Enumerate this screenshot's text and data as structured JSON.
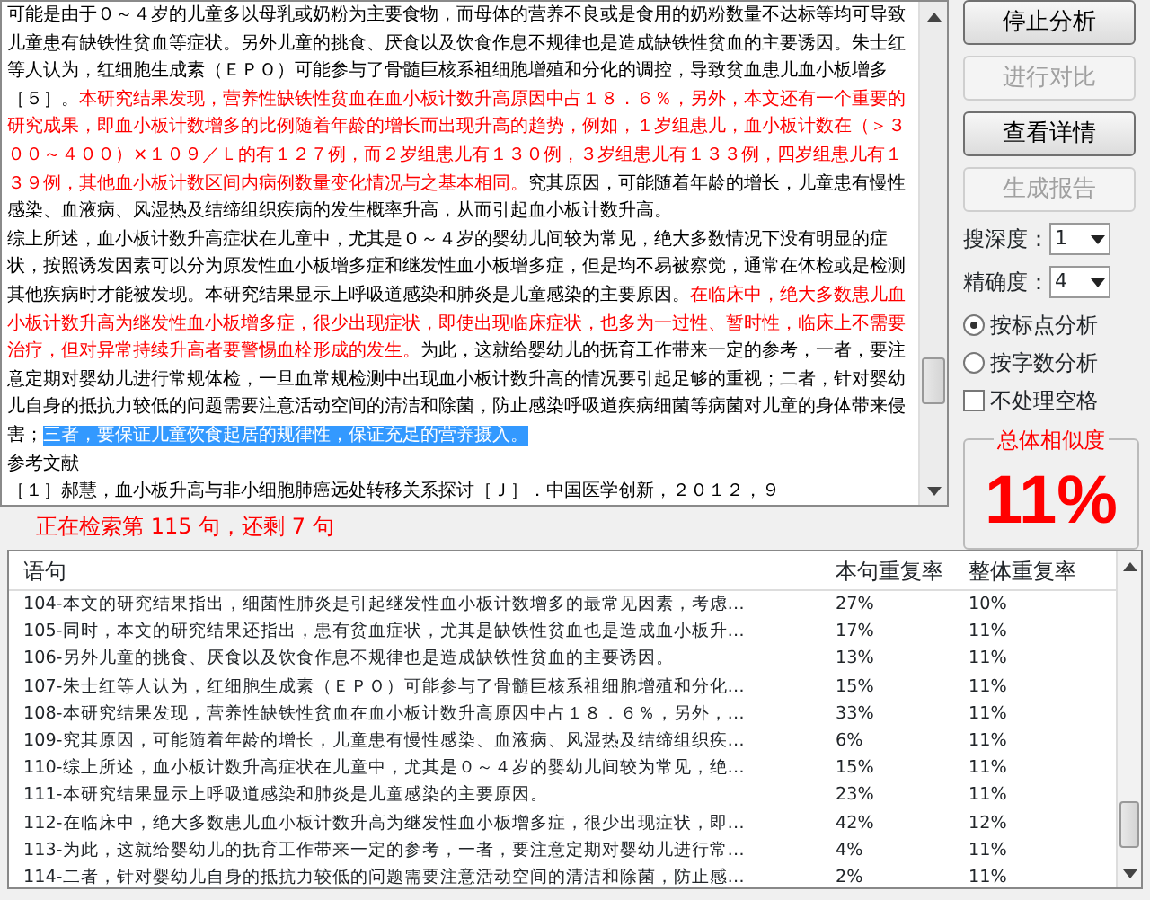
{
  "document": {
    "paragraphs": [
      {
        "segments": [
          {
            "kind": "normal",
            "text": "可能是由于０～４岁的儿童多以母乳或奶粉为主要食物，而母体的营养不良或是食用的奶粉数量不达标等均可导致儿童患有缺铁性贫血等症状。另外儿童的挑食、厌食以及饮食作息不规律也是造成缺铁性贫血的主要诱因。朱士红等人认为，红细胞生成素（ＥＰＯ）可能参与了骨髓巨核系祖细胞增殖和分化的调控，导致贫血患儿血小板增多［５］。"
          },
          {
            "kind": "flagged",
            "text": "本研究结果发现，营养性缺铁性贫血在血小板计数升高原因中占１８．６％，另外，本文还有一个重要的研究成果，即血小板计数增多的比例随着年龄的增长而出现升高的趋势，例如，１岁组患儿，血小板计数在（＞３００～４００）×１０９／Ｌ的有１２７例，而２岁组患儿有１３０例，３岁组患儿有１３３例，四岁组患儿有１３９例，其他血小板计数区间内病例数量变化情况与之基本相同。"
          },
          {
            "kind": "normal",
            "text": "究其原因，可能随着年龄的增长，儿童患有慢性感染、血液病、风湿热及结缔组织疾病的发生概率升高，从而引起血小板计数升高。"
          }
        ]
      },
      {
        "segments": [
          {
            "kind": "normal",
            "text": "综上所述，血小板计数升高症状在儿童中，尤其是０～４岁的婴幼儿间较为常见，绝大多数情况下没有明显的症状，按照诱发因素可以分为原发性血小板增多症和继发性血小板增多症，但是均不易被察觉，通常在体检或是检测其他疾病时才能被发现。本研究结果显示上呼吸道感染和肺炎是儿童感染的主要原因。"
          },
          {
            "kind": "flagged",
            "text": "在临床中，绝大多数患儿血小板计数升高为继发性血小板增多症，很少出现症状，即使出现临床症状，也多为一过性、暂时性，临床上不需要治疗，但对异常持续升高者要警惕血栓形成的发生。"
          },
          {
            "kind": "normal",
            "text": "为此，这就给婴幼儿的抚育工作带来一定的参考，一者，要注意定期对婴幼儿进行常规体检，一旦血常规检测中出现血小板计数升高的情况要引起足够的重视；二者，针对婴幼儿自身的抵抗力较低的问题需要注意活动空间的清洁和除菌，防止感染呼吸道疾病细菌等病菌对儿童的身体带来侵害；"
          },
          {
            "kind": "selected",
            "text": "三者，要保证儿童饮食起居的规律性，保证充足的营养摄入。"
          }
        ]
      },
      {
        "segments": [
          {
            "kind": "normal",
            "text": "参考文献"
          }
        ]
      },
      {
        "segments": [
          {
            "kind": "normal",
            "text": "［１］郝慧，血小板升高与非小细胞肺癌远处转移关系探讨［Ｊ］．中国医学创新，２０１２，９"
          }
        ]
      }
    ]
  },
  "status": "正在检索第 115 句，还剩 7 句",
  "buttons": [
    {
      "label": "停止分析",
      "disabled": false
    },
    {
      "label": "进行对比",
      "disabled": true
    },
    {
      "label": "查看详情",
      "disabled": false
    },
    {
      "label": "生成报告",
      "disabled": true
    }
  ],
  "selects": [
    {
      "label": "搜深度：",
      "value": "1"
    },
    {
      "label": "精确度：",
      "value": "4"
    }
  ],
  "modes": [
    {
      "label": "按标点分析",
      "selected": true
    },
    {
      "label": "按字数分析",
      "selected": false
    }
  ],
  "ignore_spaces": {
    "label": "不处理空格",
    "checked": false
  },
  "similarity": {
    "title": "总体相似度",
    "value": "11%"
  },
  "table": {
    "columns": [
      "语句",
      "本句重复率",
      "整体重复率"
    ],
    "rows": [
      [
        "104-本文的研究结果指出，细菌性肺炎是引起继发性血小板计数增多的最常见因素，考虑…",
        "27%",
        "10%"
      ],
      [
        "105-同时，本文的研究结果还指出，患有贫血症状，尤其是缺铁性贫血也是造成血小板升…",
        "17%",
        "11%"
      ],
      [
        "106-另外儿童的挑食、厌食以及饮食作息不规律也是造成缺铁性贫血的主要诱因。",
        "13%",
        "11%"
      ],
      [
        "107-朱士红等人认为，红细胞生成素（ＥＰＯ）可能参与了骨髓巨核系祖细胞增殖和分化…",
        "15%",
        "11%"
      ],
      [
        "108-本研究结果发现，营养性缺铁性贫血在血小板计数升高原因中占１８．６％，另外，…",
        "33%",
        "11%"
      ],
      [
        "109-究其原因，可能随着年龄的增长，儿童患有慢性感染、血液病、风湿热及结缔组织疾…",
        "6%",
        "11%"
      ],
      [
        "110-综上所述，血小板计数升高症状在儿童中，尤其是０～４岁的婴幼儿间较为常见，绝…",
        "15%",
        "11%"
      ],
      [
        "111-本研究结果显示上呼吸道感染和肺炎是儿童感染的主要原因。",
        "23%",
        "11%"
      ],
      [
        "112-在临床中，绝大多数患儿血小板计数升高为继发性血小板增多症，很少出现症状，即…",
        "42%",
        "12%"
      ],
      [
        "113-为此，这就给婴幼儿的抚育工作带来一定的参考，一者，要注意定期对婴幼儿进行常…",
        "4%",
        "11%"
      ],
      [
        "114-二者，针对婴幼儿自身的抵抗力较低的问题需要注意活动空间的清洁和除菌，防止感…",
        "2%",
        "11%"
      ]
    ]
  }
}
